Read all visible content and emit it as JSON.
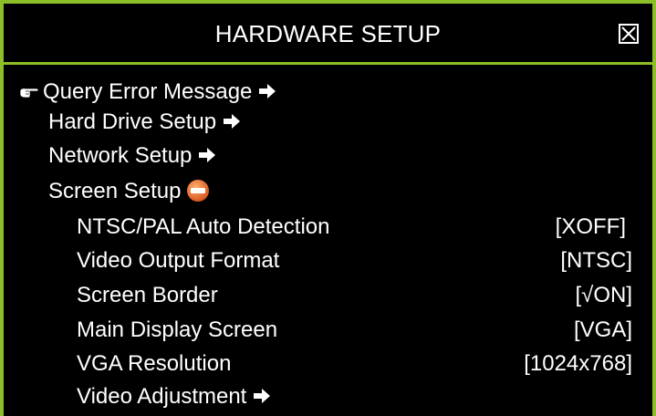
{
  "window": {
    "title": "HARDWARE SETUP"
  },
  "menu": {
    "query_error": "Query Error Message",
    "hard_drive": "Hard Drive Setup",
    "network": "Network Setup",
    "screen": "Screen Setup",
    "video_adjust": "Video Adjustment"
  },
  "screen_setup": [
    {
      "label": "NTSC/PAL Auto Detection",
      "value": "[XOFF]"
    },
    {
      "label": "Video Output Format",
      "value": "[NTSC]"
    },
    {
      "label": "Screen Border",
      "value": "[√ON]"
    },
    {
      "label": "Main Display Screen",
      "value": "[VGA]"
    },
    {
      "label": "VGA Resolution",
      "value": "[1024x768]"
    }
  ],
  "icons": {
    "close": "close-icon",
    "pointer": "hand-pointer-icon",
    "submenu": "right-arrow-icon",
    "collapse": "minus-circle-icon"
  },
  "colors": {
    "border": "#8cbe28",
    "background": "#000000",
    "text": "#ffffff",
    "collapse_icon": "#e07a28"
  }
}
